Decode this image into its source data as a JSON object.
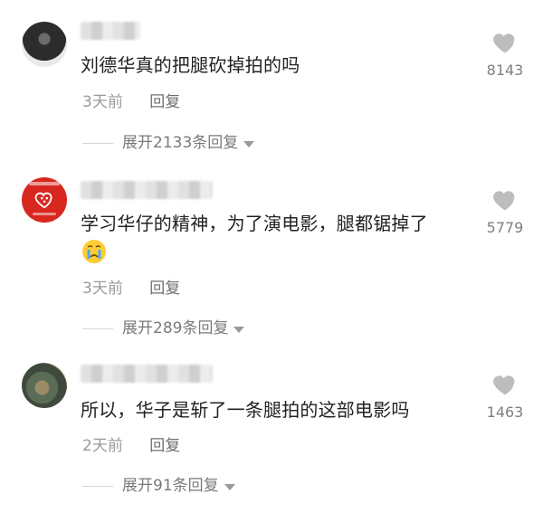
{
  "colors": {
    "text": "#222222",
    "meta": "#9a9a9a",
    "reply": "#6f6f6f",
    "heart": "#bdbdbd",
    "avatar_red": "#d8271f"
  },
  "comments": [
    {
      "username_blurred": "",
      "text": "刘德华真的把腿砍掉拍的吗",
      "time": "3天前",
      "reply_label": "回复",
      "likes": "8143",
      "expand_label": "展开2133条回复",
      "avatar_icon": "user-photo-dark"
    },
    {
      "username_blurred": "",
      "text": "学习华仔的精神，为了演电影，腿都锯掉了",
      "emoji_icon": "crying-face-emoji",
      "time": "3天前",
      "reply_label": "回复",
      "likes": "5779",
      "expand_label": "展开289条回复",
      "avatar_icon": "pinduoduo-red-logo"
    },
    {
      "username_blurred": "",
      "text": "所以，华子是斩了一条腿拍的这部电影吗",
      "time": "2天前",
      "reply_label": "回复",
      "likes": "1463",
      "expand_label": "展开91条回复",
      "avatar_icon": "user-photo-group"
    }
  ]
}
